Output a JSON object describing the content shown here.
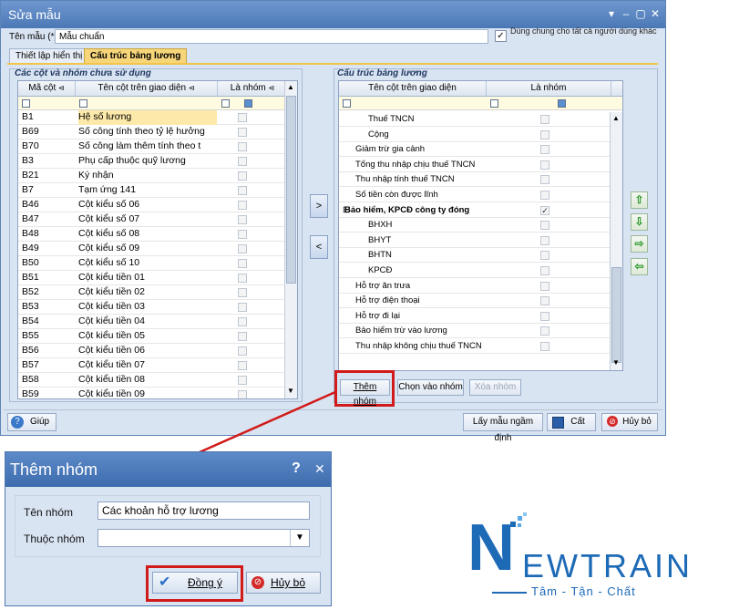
{
  "window": {
    "title": "Sửa mẫu",
    "template_name_label": "Tên mẫu (*)",
    "template_name_value": "Mẫu chuẩn",
    "shared_label": "Dùng chung cho tất cả người dùng khác",
    "shared_checked": true
  },
  "tabs": [
    "Thiết lập hiển thị",
    "Cấu trúc bảng lương"
  ],
  "left_panel": {
    "title": "Các cột và nhóm chưa sử dụng",
    "headers": [
      "Mã cột",
      "Tên cột trên giao diện",
      "Là nhóm"
    ],
    "rows": [
      {
        "code": "B1",
        "name": "Hệ số lương"
      },
      {
        "code": "B69",
        "name": "Số công tính theo tỷ lệ hưởng"
      },
      {
        "code": "B70",
        "name": "Số công làm thêm tính theo t"
      },
      {
        "code": "B3",
        "name": "Phụ cấp thuộc quỹ lương"
      },
      {
        "code": "B21",
        "name": "Ký nhận"
      },
      {
        "code": "B7",
        "name": "Tạm ứng 141"
      },
      {
        "code": "B46",
        "name": "Cột kiểu số 06"
      },
      {
        "code": "B47",
        "name": "Cột kiểu số 07"
      },
      {
        "code": "B48",
        "name": "Cột kiểu số 08"
      },
      {
        "code": "B49",
        "name": "Cột kiểu số 09"
      },
      {
        "code": "B50",
        "name": "Cột kiểu số 10"
      },
      {
        "code": "B51",
        "name": "Cột kiểu tiền 01"
      },
      {
        "code": "B52",
        "name": "Cột kiểu tiền 02"
      },
      {
        "code": "B53",
        "name": "Cột kiểu tiền 03"
      },
      {
        "code": "B54",
        "name": "Cột kiểu tiền 04"
      },
      {
        "code": "B55",
        "name": "Cột kiểu tiền 05"
      },
      {
        "code": "B56",
        "name": "Cột kiểu tiền 06"
      },
      {
        "code": "B57",
        "name": "Cột kiểu tiền 07"
      },
      {
        "code": "B58",
        "name": "Cột kiểu tiền 08"
      },
      {
        "code": "B59",
        "name": "Cột kiểu tiền 09"
      }
    ]
  },
  "move_buttons": {
    "add": ">",
    "remove": "<"
  },
  "right_panel": {
    "title": "Cấu trúc bảng lương",
    "headers": [
      "Tên cột trên giao diện",
      "Là nhóm"
    ],
    "rows": [
      {
        "name": "Thuế TNCN",
        "indent": 2,
        "group": false,
        "bold": false
      },
      {
        "name": "Cộng",
        "indent": 2,
        "group": false,
        "bold": false
      },
      {
        "name": "Giảm trừ gia cảnh",
        "indent": 1,
        "group": false,
        "bold": false
      },
      {
        "name": "Tổng thu nhập chịu thuế TNCN",
        "indent": 1,
        "group": false,
        "bold": false
      },
      {
        "name": "Thu nhập tính thuế TNCN",
        "indent": 1,
        "group": false,
        "bold": false
      },
      {
        "name": "Số tiền còn được lĩnh",
        "indent": 1,
        "group": false,
        "bold": false
      },
      {
        "name": "Bảo hiểm, KPCĐ công ty đóng",
        "indent": 0,
        "group": true,
        "bold": true
      },
      {
        "name": "BHXH",
        "indent": 2,
        "group": false,
        "bold": false
      },
      {
        "name": "BHYT",
        "indent": 2,
        "group": false,
        "bold": false
      },
      {
        "name": "BHTN",
        "indent": 2,
        "group": false,
        "bold": false
      },
      {
        "name": "KPCĐ",
        "indent": 2,
        "group": false,
        "bold": false
      },
      {
        "name": "Hỗ trợ ăn trưa",
        "indent": 1,
        "group": false,
        "bold": false
      },
      {
        "name": "Hỗ trợ điện thoại",
        "indent": 1,
        "group": false,
        "bold": false
      },
      {
        "name": "Hỗ trợ đi lại",
        "indent": 1,
        "group": false,
        "bold": false
      },
      {
        "name": "Bảo hiểm trừ vào lương",
        "indent": 1,
        "group": false,
        "bold": false
      },
      {
        "name": "Thu nhập không chịu thuế TNCN",
        "indent": 1,
        "group": false,
        "bold": false
      }
    ],
    "group_expander": "⊟"
  },
  "group_buttons": {
    "add_group": "Thêm nhóm",
    "choose_group": "Chọn vào nhóm",
    "delete_group": "Xóa nhóm"
  },
  "bottom_bar": {
    "help": "Giúp",
    "default_template": "Lấy mẫu ngầm định",
    "save": "Cất",
    "cancel": "Hủy bỏ"
  },
  "dialog": {
    "title": "Thêm nhóm",
    "help_symbol": "?",
    "close_symbol": "✕",
    "group_name_label": "Tên nhóm",
    "group_name_value": "Các khoản hỗ trợ lương",
    "parent_group_label": "Thuộc nhóm",
    "parent_group_value": "",
    "ok": "Đồng ý",
    "cancel": "Hủy bỏ"
  },
  "logo": {
    "first_letter": "N",
    "rest": "EWTRAIN",
    "tagline": "Tâm - Tận - Chất"
  },
  "colors": {
    "accent_tab": "#f7d67a",
    "highlight_frame": "#d11a1a",
    "brand_blue": "#1d6ab7",
    "selected_row": "#fde9a9"
  }
}
